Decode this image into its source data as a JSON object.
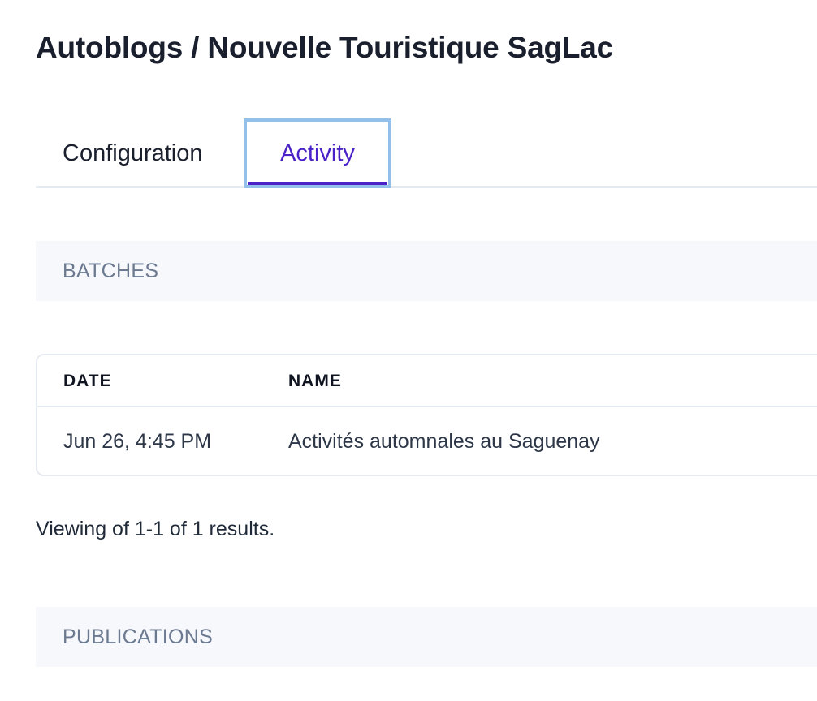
{
  "header": {
    "title": "Autoblogs / Nouvelle Touristique SagLac"
  },
  "tabs": [
    {
      "label": "Configuration",
      "active": false
    },
    {
      "label": "Activity",
      "active": true
    }
  ],
  "batches": {
    "title": "BATCHES",
    "columns": [
      "DATE",
      "NAME"
    ],
    "rows": [
      {
        "date": "Jun 26, 4:45 PM",
        "name": "Activités automnales au Saguenay"
      }
    ],
    "results_text": "Viewing of 1-1 of 1 results."
  },
  "publications": {
    "title": "PUBLICATIONS"
  },
  "colors": {
    "accent": "#4a22c8",
    "focus_ring": "#93c0ea",
    "section_bg": "#f7f8fb",
    "section_text": "#6b7a90",
    "border": "#e5e9f0"
  }
}
